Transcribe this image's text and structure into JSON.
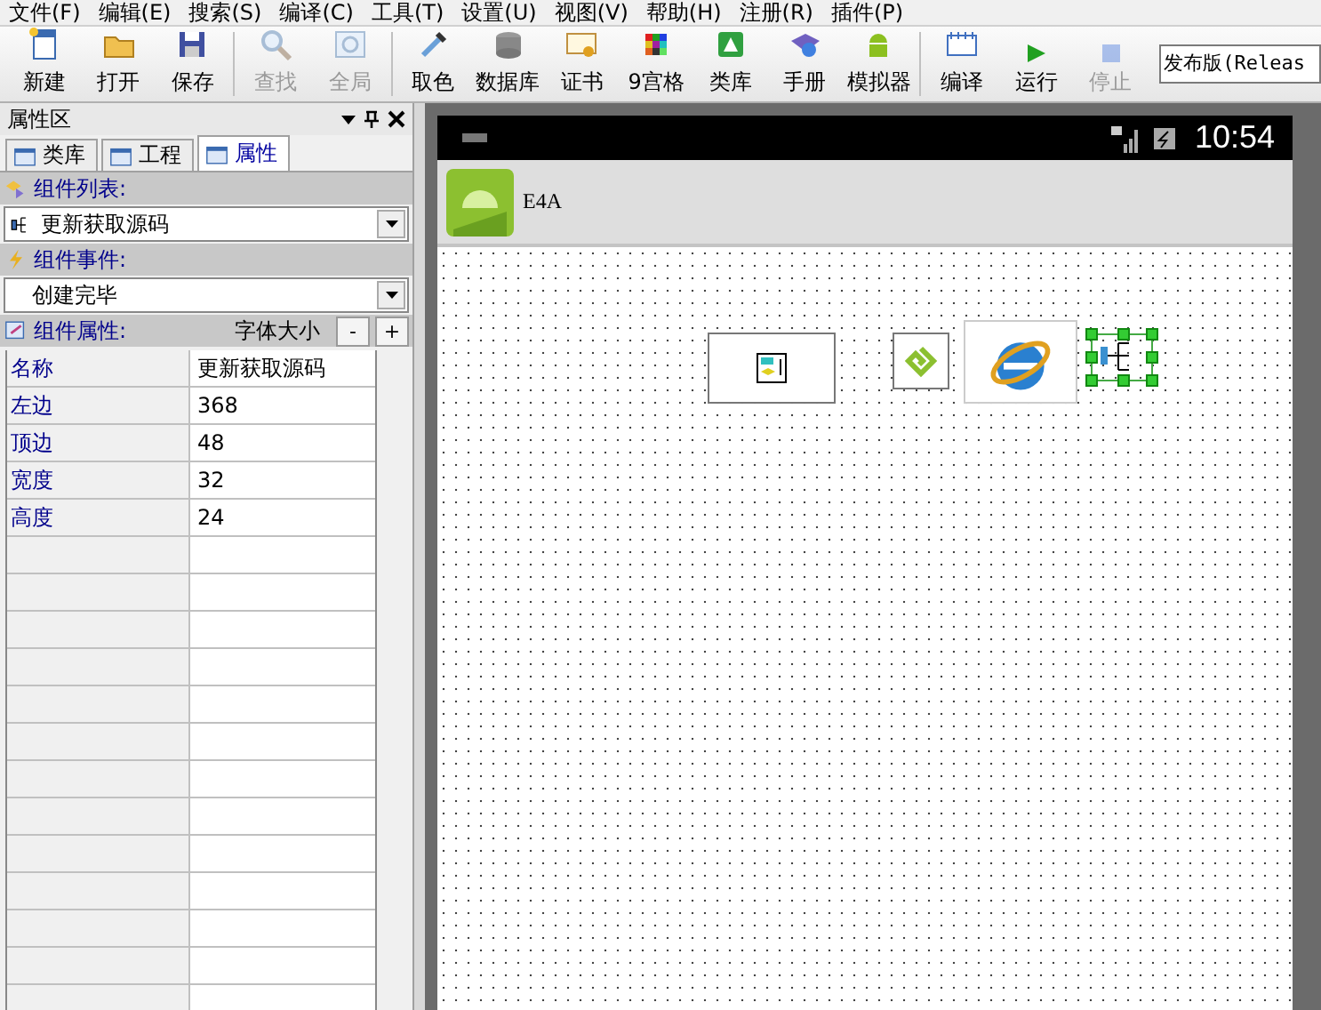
{
  "menu": [
    "文件(F)",
    "编辑(E)",
    "搜索(S)",
    "编译(C)",
    "工具(T)",
    "设置(U)",
    "视图(V)",
    "帮助(H)",
    "注册(R)",
    "插件(P)"
  ],
  "toolbar": [
    {
      "label": "新建",
      "disabled": false
    },
    {
      "label": "打开",
      "disabled": false
    },
    {
      "label": "保存",
      "disabled": false
    },
    {
      "label": "查找",
      "disabled": true
    },
    {
      "label": "全局",
      "disabled": true
    },
    {
      "label": "取色",
      "disabled": false
    },
    {
      "label": "数据库",
      "disabled": false
    },
    {
      "label": "证书",
      "disabled": false
    },
    {
      "label": "9宫格",
      "disabled": false
    },
    {
      "label": "类库",
      "disabled": false
    },
    {
      "label": "手册",
      "disabled": false
    },
    {
      "label": "模拟器",
      "disabled": false
    },
    {
      "label": "编译",
      "disabled": false
    },
    {
      "label": "运行",
      "disabled": false
    },
    {
      "label": "停止",
      "disabled": true
    }
  ],
  "build_select": {
    "value": "发布版(Releas"
  },
  "panel": {
    "title": "属性区",
    "tabs": [
      {
        "label": "类库",
        "selected": false
      },
      {
        "label": "工程",
        "selected": false
      },
      {
        "label": "属性",
        "selected": true
      }
    ],
    "component_list": {
      "label": "组件列表:",
      "value": "更新获取源码"
    },
    "component_events": {
      "label": "组件事件:",
      "value": "创建完毕"
    },
    "component_props": {
      "label": "组件属性:",
      "font_size_label": "字体大小",
      "minus": "-",
      "plus": "+"
    },
    "properties": [
      {
        "name": "名称",
        "value": "更新获取源码"
      },
      {
        "name": "左边",
        "value": "368"
      },
      {
        "name": "顶边",
        "value": "48"
      },
      {
        "name": "宽度",
        "value": "32"
      },
      {
        "name": "高度",
        "value": "24"
      }
    ]
  },
  "phone": {
    "time": "10:54",
    "app_title": "E4A"
  }
}
